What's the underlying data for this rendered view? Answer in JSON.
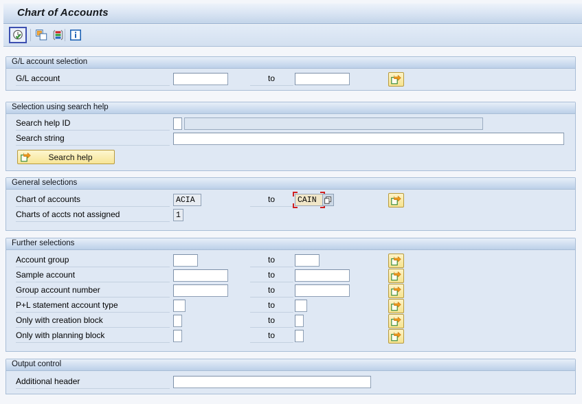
{
  "window": {
    "title": "Chart of Accounts"
  },
  "toolbar": {
    "buttons": [
      {
        "name": "execute-button",
        "icon": "clock-check-icon",
        "focused": true
      },
      {
        "name": "multiple-selection-button",
        "icon": "copy-windows-icon",
        "focused": false
      },
      {
        "name": "select-layout-button",
        "icon": "variant-stripes-icon",
        "focused": false
      },
      {
        "name": "information-button",
        "icon": "info-icon",
        "focused": false
      }
    ]
  },
  "sections": {
    "gl_account_selection": {
      "header": "G/L account selection",
      "rows": [
        {
          "label": "G/L account",
          "from_value": "",
          "to_label": "to",
          "to_value": "",
          "multi_select": true
        }
      ]
    },
    "search_help": {
      "header": "Selection using search help",
      "search_help_id_label": "Search help ID",
      "search_help_id_value": "",
      "search_help_id_desc": "",
      "search_string_label": "Search string",
      "search_string_value": "",
      "search_help_button": "Search help"
    },
    "general_selections": {
      "header": "General selections",
      "rows": [
        {
          "label": "Chart of accounts",
          "from_value": "ACIA",
          "to_label": "to",
          "to_value": "CAIN",
          "multi_select": true,
          "focused": true
        },
        {
          "label": "Charts of accts not assigned",
          "from_value": "1",
          "to_label": "",
          "to_value": "",
          "multi_select": false
        }
      ]
    },
    "further_selections": {
      "header": "Further selections",
      "rows": [
        {
          "label": "Account group",
          "from_value": "",
          "to_label": "to",
          "to_value": "",
          "width": "small",
          "multi_select": true
        },
        {
          "label": "Sample account",
          "from_value": "",
          "to_label": "to",
          "to_value": "",
          "width": "large",
          "multi_select": true
        },
        {
          "label": "Group account number",
          "from_value": "",
          "to_label": "to",
          "to_value": "",
          "width": "large",
          "multi_select": true
        },
        {
          "label": "P+L statement account type",
          "from_value": "",
          "to_label": "to",
          "to_value": "",
          "width": "tiny",
          "multi_select": true
        },
        {
          "label": "Only with creation block",
          "from_value": "",
          "to_label": "to",
          "to_value": "",
          "width": "mini",
          "multi_select": true
        },
        {
          "label": "Only with planning block",
          "from_value": "",
          "to_label": "to",
          "to_value": "",
          "width": "mini",
          "multi_select": true
        }
      ]
    },
    "output_control": {
      "header": "Output control",
      "rows": [
        {
          "label": "Additional header",
          "from_value": ""
        }
      ]
    }
  },
  "colors": {
    "panel_body": "#dfe8f4",
    "panel_header_end": "#bcd0e8",
    "focus_border": "#d02020",
    "button_yellow": "#f7e596",
    "toolbar_focus": "#3c4fb0"
  }
}
